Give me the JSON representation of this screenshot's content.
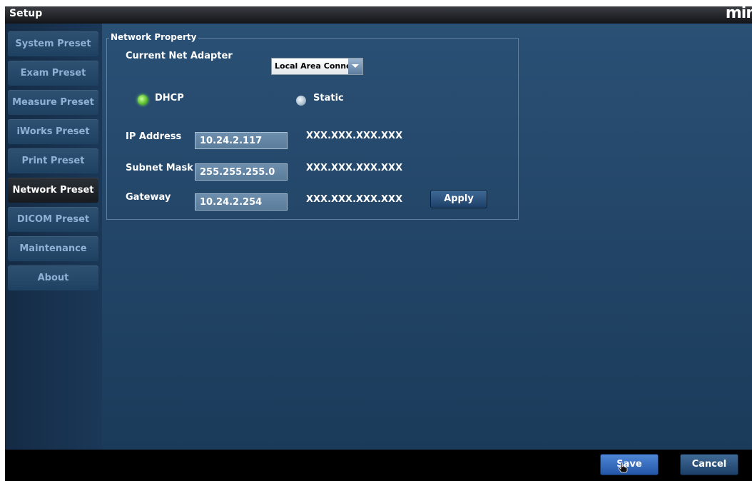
{
  "window": {
    "title": "Setup",
    "brand": "min"
  },
  "sidebar": {
    "items": [
      {
        "label": "System Preset"
      },
      {
        "label": "Exam Preset"
      },
      {
        "label": "Measure Preset"
      },
      {
        "label": "iWorks Preset"
      },
      {
        "label": "Print Preset"
      },
      {
        "label": "Network Preset",
        "active": true
      },
      {
        "label": "DICOM Preset"
      },
      {
        "label": "Maintenance"
      },
      {
        "label": "About"
      }
    ]
  },
  "network": {
    "group_title": "Network Property",
    "adapter_label": "Current Net Adapter",
    "adapter_value": "Local Area Connec",
    "dhcp_label": "DHCP",
    "static_label": "Static",
    "mode": "DHCP",
    "ip_label": "IP Address",
    "ip_value": "10.24.2.117",
    "subnet_label": "Subnet Mask",
    "subnet_value": "255.255.255.0",
    "gateway_label": "Gateway",
    "gateway_value": "10.24.2.254",
    "format_hint": "XXX.XXX.XXX.XXX",
    "apply_label": "Apply"
  },
  "footer": {
    "save_label": "Save",
    "cancel_label": "Cancel"
  },
  "colors": {
    "dhcp_radio": "#5bbf2a",
    "content_bg": "#2a5075",
    "save_button": "#3a6fc0"
  },
  "icons": {
    "combo_arrow": "chevron-down-icon",
    "cursor": "hand-pointer-icon"
  }
}
